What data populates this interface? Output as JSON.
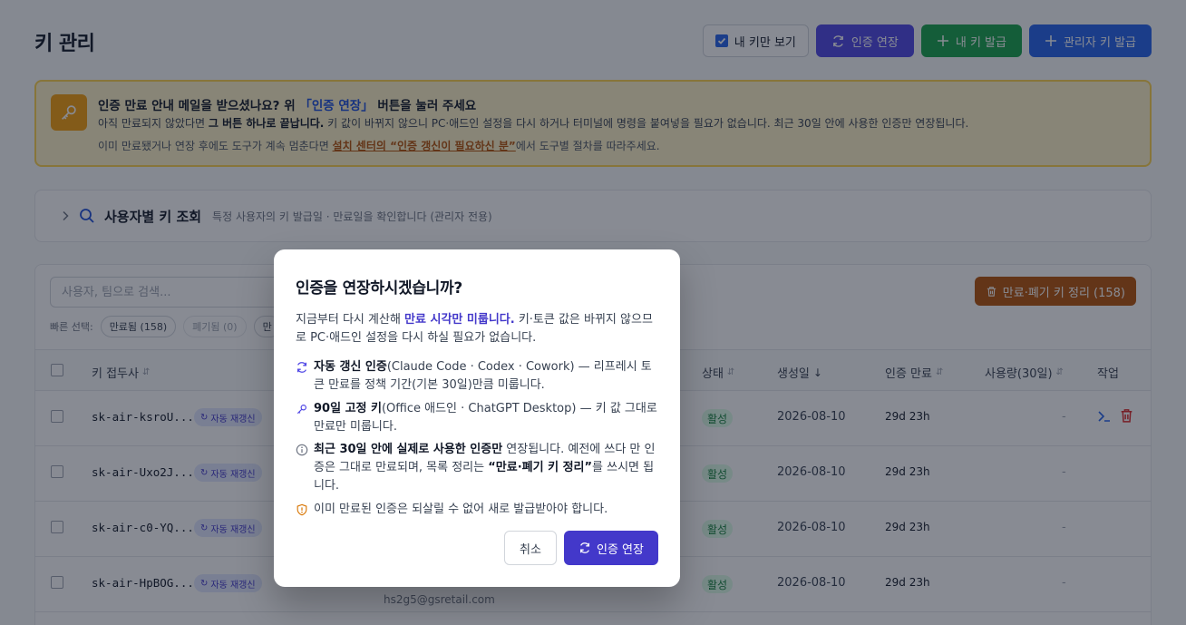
{
  "header": {
    "title": "키 관리",
    "my_keys_only_label": "내 키만 보기",
    "extend_auth_label": "인증 연장",
    "issue_my_key_label": "내 키 발급",
    "issue_admin_key_label": "관리자 키 발급"
  },
  "banner": {
    "title_pre": "인증 만료 안내 메일을 받으셨나요? 위 ",
    "title_hl": "「인증 연장」",
    "title_post": " 버튼을 눌러 주세요",
    "line1_pre": "아직 만료되지 않았다면 ",
    "line1_bold": "그 버튼 하나로 끝납니다.",
    "line1_post": " 키 값이 바뀌지 않으니 PC·애드인 설정을 다시 하거나 터미널에 명령을 붙여넣을 필요가 없습니다. 최근 30일 안에 사용한 인증만 연장됩니다.",
    "line2_pre": "이미 만료됐거나 연장 후에도 도구가 계속 멈춘다면 ",
    "line2_link": "설치 센터의 “인증 갱신이 필요하신 분”",
    "line2_post": "에서 도구별 절차를 따라주세요."
  },
  "lookup": {
    "title": "사용자별 키 조회",
    "desc": "특정 사용자의 키 발급일 · 만료일을 확인합니다 (관리자 전용)"
  },
  "list": {
    "search_placeholder": "사용자, 팀으로 검색...",
    "cleanup_label": "만료·폐기 키 정리 (158)",
    "quick_label": "빠른 선택:",
    "chips": [
      "만료됨 (158)",
      "폐기됨 (0)",
      "만"
    ],
    "columns": {
      "key": "키 접두사",
      "status": "상태",
      "created": "생성일",
      "expires": "인증 만료",
      "usage": "사용량(30일)",
      "actions": "작업"
    },
    "rows": [
      {
        "key": "sk-air-ksroU...",
        "tag": "자동 재갱신",
        "status": "활성",
        "created": "2026-08-10",
        "expires": "29d 23h",
        "usage": "-"
      },
      {
        "key": "sk-air-Uxo2J...",
        "tag": "자동 재갱신",
        "status": "활성",
        "created": "2026-08-10",
        "expires": "29d 23h",
        "usage": "-"
      },
      {
        "key": "sk-air-c0-YQ...",
        "tag": "자동 재갱신",
        "status": "활성",
        "created": "2026-08-10",
        "expires": "29d 23h",
        "usage": "-"
      },
      {
        "key": "sk-air-HpBOG...",
        "tag": "자동 재갱신",
        "status": "활성",
        "created": "2026-08-10",
        "expires": "29d 23h",
        "usage": "-",
        "owner_email": "hs2g5@gsretail.com"
      }
    ]
  },
  "modal": {
    "title": "인증을 연장하시겠습니까?",
    "lead_pre": "지금부터 다시 계산해 ",
    "lead_bold": "만료 시각만 미룹니다.",
    "lead_post": " 키·토큰 값은 바뀌지 않으므로 PC·애드인 설정을 다시 하실 필요가 없습니다.",
    "item1_bold": "자동 갱신 인증",
    "item1_text": "(Claude Code · Codex · Cowork) — 리프레시 토큰 만료를 정책 기간(기본 30일)만큼 미룹니다.",
    "item2_bold": "90일 고정 키",
    "item2_text": "(Office 애드인 · ChatGPT Desktop) — 키 값 그대로 만료만 미룹니다.",
    "item3_bold": "최근 30일 안에 실제로 사용한 인증만",
    "item3_mid": " 연장됩니다. 예전에 쓰다 만 인증은 그대로 만료되며, 목록 정리는 ",
    "item3_bold2": "“만료·폐기 키 정리”",
    "item3_post": "를 쓰시면 됩니다.",
    "item4_text": "이미 만료된 인증은 되살릴 수 없어 새로 발급받아야 합니다.",
    "cancel_label": "취소",
    "confirm_label": "인증 연장"
  },
  "colors": {
    "indigo": "#4f46e5",
    "green": "#16a34a",
    "blue": "#2563eb",
    "amber": "#b45309",
    "banner_bg": "#fef3c7",
    "active_badge": "#dcfce7"
  }
}
